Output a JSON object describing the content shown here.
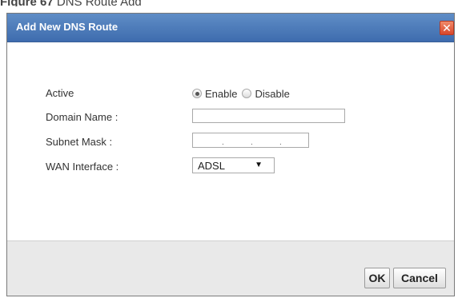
{
  "caption": {
    "label": "Figure 67",
    "text": "DNS Route Add"
  },
  "dialog": {
    "title": "Add New DNS Route",
    "close_symbol": "✕"
  },
  "form": {
    "active": {
      "label": "Active",
      "options": [
        "Enable",
        "Disable"
      ],
      "selected": "Enable"
    },
    "domain_name": {
      "label": "Domain Name :",
      "value": ""
    },
    "subnet_mask": {
      "label": "Subnet Mask :",
      "value": ". . ."
    },
    "wan_interface": {
      "label": "WAN Interface :",
      "selected": "ADSL"
    }
  },
  "footer": {
    "ok_label": "OK",
    "cancel_label": "Cancel"
  },
  "icons": {
    "close": "close-icon",
    "dropdown": "chevron-down-icon"
  },
  "colors": {
    "titlebar": "#4a78b8",
    "close_button": "#e0553a",
    "footer_bg": "#e9e9e9"
  }
}
